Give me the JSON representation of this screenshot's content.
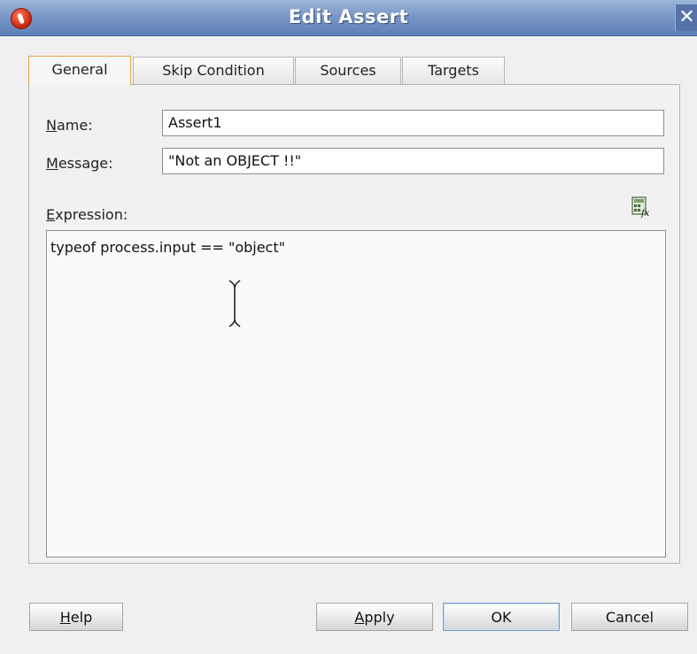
{
  "window": {
    "title": "Edit Assert",
    "close_glyph": "✕"
  },
  "tabs": [
    {
      "label": "General",
      "active": true
    },
    {
      "label": "Skip Condition",
      "active": false
    },
    {
      "label": "Sources",
      "active": false
    },
    {
      "label": "Targets",
      "active": false
    }
  ],
  "general": {
    "name_label_mnemonic": "N",
    "name_label_rest": "ame:",
    "name_value": "Assert1",
    "message_label_mnemonic": "M",
    "message_label_rest": "essage:",
    "message_value": "\"Not an OBJECT !!\"",
    "expression_label_mnemonic": "E",
    "expression_label_rest": "xpression:",
    "expression_value": "typeof process.input == \"object\"",
    "expression_builder_icon": "expression-builder-icon"
  },
  "buttons": {
    "help_mnemonic": "H",
    "help_rest": "elp",
    "apply_mnemonic": "A",
    "apply_rest": "pply",
    "ok": "OK",
    "cancel": "Cancel"
  },
  "colors": {
    "titlebar": "#7a98c6",
    "active_tab_border": "#e3a640",
    "default_button_border": "#7a9cc4"
  }
}
